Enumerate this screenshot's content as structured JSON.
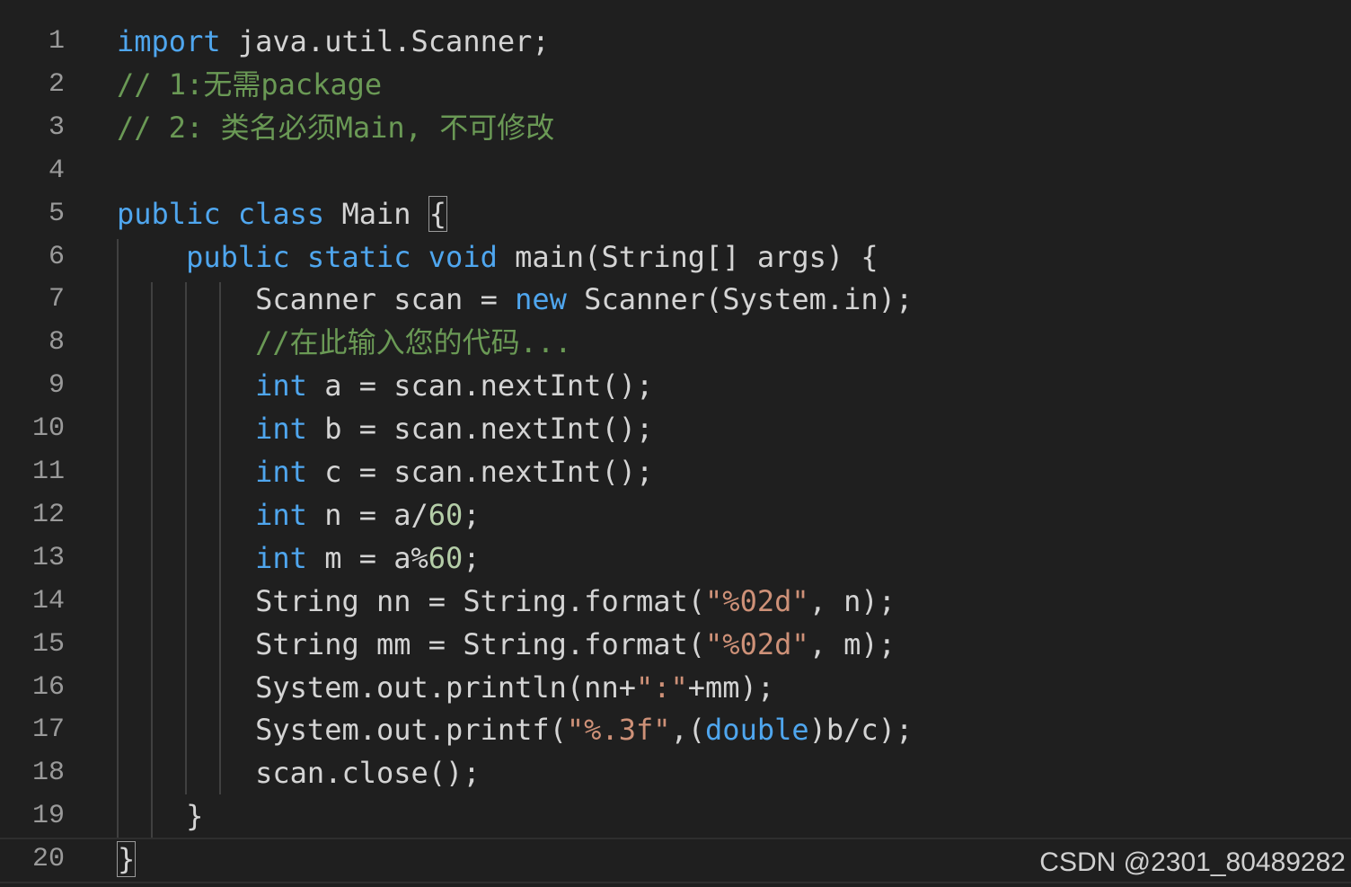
{
  "lines": [
    {
      "num": "1",
      "tokens": [
        {
          "t": "kw",
          "v": "import"
        },
        {
          "t": "p",
          "v": " java.util.Scanner;"
        }
      ]
    },
    {
      "num": "2",
      "tokens": [
        {
          "t": "cm",
          "v": "// 1:无需package"
        }
      ]
    },
    {
      "num": "3",
      "tokens": [
        {
          "t": "cm",
          "v": "// 2: 类名必须Main, 不可修改"
        }
      ]
    },
    {
      "num": "4",
      "tokens": []
    },
    {
      "num": "5",
      "tokens": [
        {
          "t": "kw",
          "v": "public"
        },
        {
          "t": "p",
          "v": " "
        },
        {
          "t": "kw",
          "v": "class"
        },
        {
          "t": "p",
          "v": " Main "
        },
        {
          "t": "box",
          "v": "{"
        }
      ]
    },
    {
      "num": "6",
      "tokens": [
        {
          "t": "p",
          "v": "    "
        },
        {
          "t": "kw",
          "v": "public"
        },
        {
          "t": "p",
          "v": " "
        },
        {
          "t": "kw",
          "v": "static"
        },
        {
          "t": "p",
          "v": " "
        },
        {
          "t": "kw",
          "v": "void"
        },
        {
          "t": "p",
          "v": " main(String[] args) {"
        }
      ]
    },
    {
      "num": "7",
      "tokens": [
        {
          "t": "p",
          "v": "        Scanner scan = "
        },
        {
          "t": "kw",
          "v": "new"
        },
        {
          "t": "p",
          "v": " Scanner(System.in);"
        }
      ]
    },
    {
      "num": "8",
      "tokens": [
        {
          "t": "p",
          "v": "        "
        },
        {
          "t": "cm",
          "v": "//在此输入您的代码..."
        }
      ]
    },
    {
      "num": "9",
      "tokens": [
        {
          "t": "p",
          "v": "        "
        },
        {
          "t": "kw",
          "v": "int"
        },
        {
          "t": "p",
          "v": " a = scan.nextInt();"
        }
      ]
    },
    {
      "num": "10",
      "tokens": [
        {
          "t": "p",
          "v": "        "
        },
        {
          "t": "kw",
          "v": "int"
        },
        {
          "t": "p",
          "v": " b = scan.nextInt();"
        }
      ]
    },
    {
      "num": "11",
      "tokens": [
        {
          "t": "p",
          "v": "        "
        },
        {
          "t": "kw",
          "v": "int"
        },
        {
          "t": "p",
          "v": " c = scan.nextInt();"
        }
      ]
    },
    {
      "num": "12",
      "tokens": [
        {
          "t": "p",
          "v": "        "
        },
        {
          "t": "kw",
          "v": "int"
        },
        {
          "t": "p",
          "v": " n = a/"
        },
        {
          "t": "num",
          "v": "60"
        },
        {
          "t": "p",
          "v": ";"
        }
      ]
    },
    {
      "num": "13",
      "tokens": [
        {
          "t": "p",
          "v": "        "
        },
        {
          "t": "kw",
          "v": "int"
        },
        {
          "t": "p",
          "v": " m = a%"
        },
        {
          "t": "num",
          "v": "60"
        },
        {
          "t": "p",
          "v": ";"
        }
      ]
    },
    {
      "num": "14",
      "tokens": [
        {
          "t": "p",
          "v": "        String nn = String.format("
        },
        {
          "t": "str",
          "v": "\"%02d\""
        },
        {
          "t": "p",
          "v": ", n);"
        }
      ]
    },
    {
      "num": "15",
      "tokens": [
        {
          "t": "p",
          "v": "        String mm = String.format("
        },
        {
          "t": "str",
          "v": "\"%02d\""
        },
        {
          "t": "p",
          "v": ", m);"
        }
      ]
    },
    {
      "num": "16",
      "tokens": [
        {
          "t": "p",
          "v": "        System.out.println(nn+"
        },
        {
          "t": "str",
          "v": "\":\""
        },
        {
          "t": "p",
          "v": "+mm);"
        }
      ]
    },
    {
      "num": "17",
      "tokens": [
        {
          "t": "p",
          "v": "        System.out.printf("
        },
        {
          "t": "str",
          "v": "\"%.3f\""
        },
        {
          "t": "p",
          "v": ",("
        },
        {
          "t": "kw",
          "v": "double"
        },
        {
          "t": "p",
          "v": ")b/c);"
        }
      ]
    },
    {
      "num": "18",
      "tokens": [
        {
          "t": "p",
          "v": "        scan.close();"
        }
      ]
    },
    {
      "num": "19",
      "tokens": [
        {
          "t": "p",
          "v": "    }"
        }
      ]
    },
    {
      "num": "20",
      "tokens": [
        {
          "t": "box",
          "v": "}"
        }
      ]
    }
  ],
  "watermark": "CSDN @2301_80489282",
  "colors": {
    "background": "#1f1f1f",
    "keyword": "#4fa6ee",
    "comment": "#6a9955",
    "number": "#b5cea8",
    "string": "#ce9178",
    "plain": "#d4d4d4",
    "line_number": "#9a9a9a"
  }
}
